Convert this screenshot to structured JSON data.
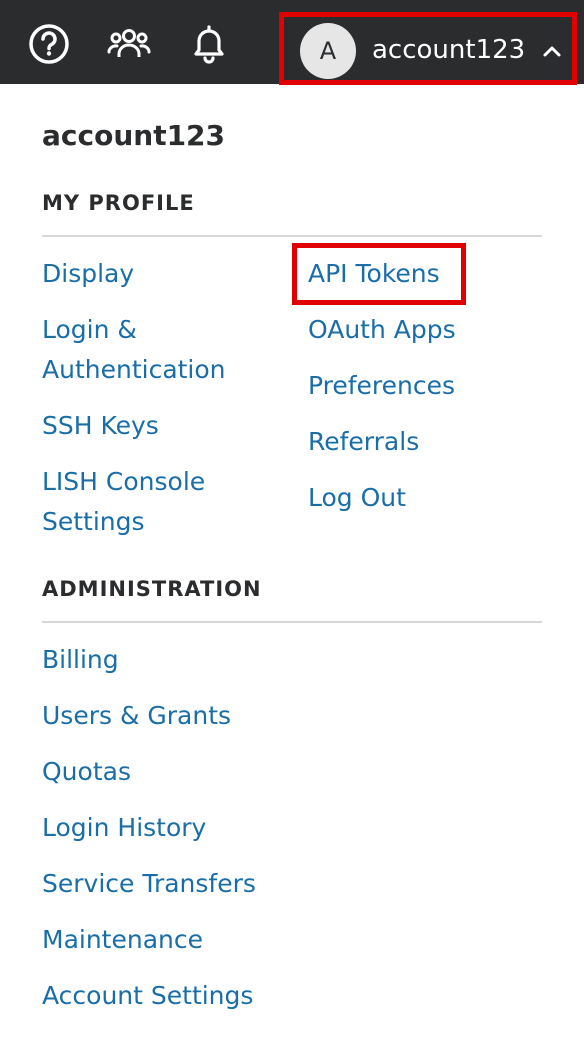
{
  "topbar": {
    "icons": [
      "help-icon",
      "community-icon",
      "notifications-icon"
    ],
    "avatar_letter": "A",
    "username": "account123",
    "chevron": "chevron-up-icon"
  },
  "menu": {
    "title": "account123",
    "my_profile": {
      "heading": "MY PROFILE",
      "left_links": [
        "Display",
        "Login &",
        "Authentication",
        "SSH Keys",
        "LISH Console",
        "Settings"
      ],
      "right_links": [
        "API Tokens",
        "OAuth Apps",
        "Preferences",
        "Referrals",
        "Log Out"
      ]
    },
    "administration": {
      "heading": "ADMINISTRATION",
      "links": [
        "Billing",
        "Users & Grants",
        "Quotas",
        "Login History",
        "Service Transfers",
        "Maintenance",
        "Account Settings"
      ]
    }
  },
  "colors": {
    "topbar": "#2b2c2e",
    "link": "#1a6ea8",
    "highlight": "#e00000"
  }
}
